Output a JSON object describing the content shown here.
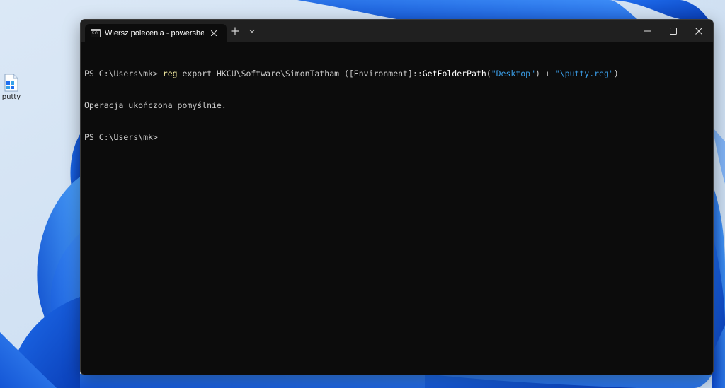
{
  "desktop": {
    "icons": [
      {
        "label": "putty",
        "icon": "putty-registry-file-icon"
      }
    ]
  },
  "terminal": {
    "tab": {
      "title": "Wiersz polecenia - powershell",
      "icon": "command-prompt-icon",
      "close_icon": "close-icon"
    },
    "toolbar": {
      "new_tab_icon": "plus-icon",
      "dropdown_icon": "chevron-down-icon"
    },
    "window_controls": {
      "minimize_icon": "minimize-icon",
      "maximize_icon": "maximize-icon",
      "close_icon": "close-icon"
    },
    "lines": {
      "line1": {
        "prompt": "PS C:\\Users\\mk> ",
        "cmd": "reg",
        "args": " export HKCU\\Software\\SimonTatham ([Environment]::",
        "method": "GetFolderPath",
        "open_paren": "(",
        "str1": "\"Desktop\"",
        "close_paren": ")",
        "plus": " + ",
        "str2": "\"\\putty.reg\"",
        "end": ")"
      },
      "line2": {
        "text": "Operacja ukończona pomyślnie."
      },
      "line3": {
        "prompt": "PS C:\\Users\\mk>"
      }
    },
    "colors": {
      "background": "#0c0c0c",
      "titlebar": "#202020",
      "text": "#cccccc",
      "command": "#f9f1a5",
      "string": "#3b9ee8"
    }
  }
}
